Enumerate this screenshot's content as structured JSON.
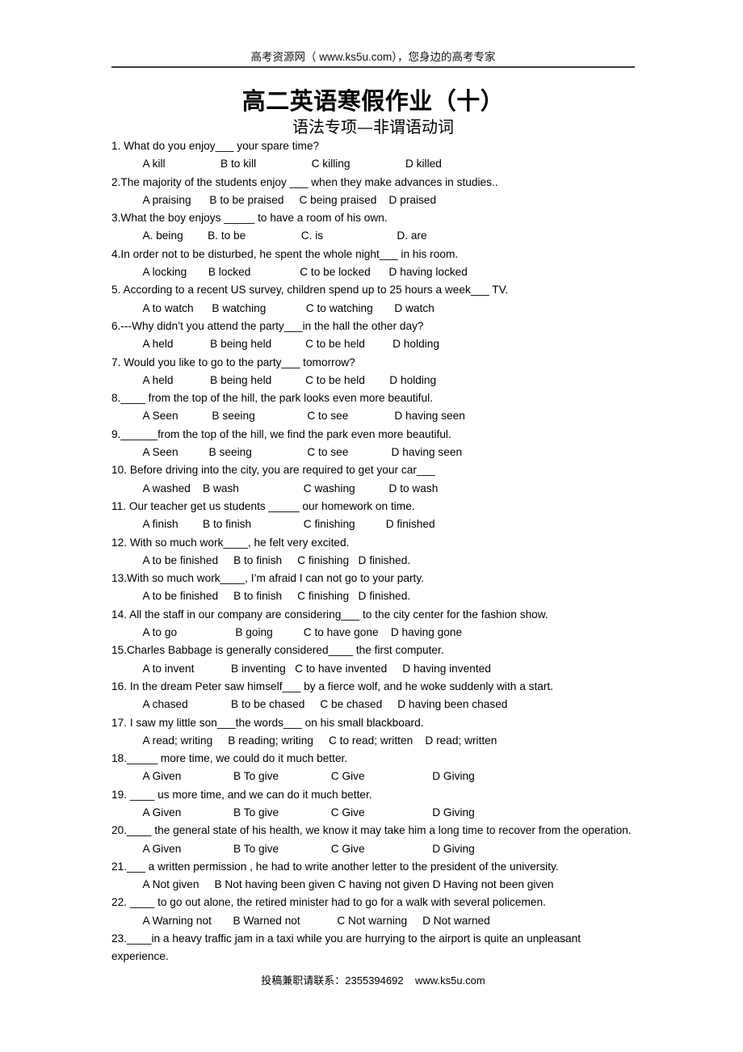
{
  "header": {
    "text": "高考资源网（ www.ks5u.com），您身边的高考专家"
  },
  "title": "高二英语寒假作业（十）",
  "subtitle": "语法专项—非谓语动词",
  "questions": [
    {
      "stem": "1. What do you enjoy___ your spare time?",
      "options": "    A kill                  B to kill                  C killing                  D killed"
    },
    {
      "stem": "2.The majority of the students enjoy ___ when they make advances in studies..",
      "options": "    A praising      B to be praised     C being praised    D praised"
    },
    {
      "stem": "3.What the boy enjoys _____ to have a room of his own.",
      "options": "    A. being        B. to be                  C. is                        D. are"
    },
    {
      "stem": "4.In order not to be disturbed, he spent the whole night___ in his room.",
      "options": "    A locking       B locked                C to be locked      D having locked"
    },
    {
      "stem": "5. According to a recent US survey, children spend up to 25 hours a week___ TV.",
      "options": "    A to watch      B watching             C to watching       D watch"
    },
    {
      "stem": "6.---Why didn’t you attend the party___in the hall the other day?",
      "options": "    A held            B being held           C to be held         D holding"
    },
    {
      "stem": "7. Would you like to go to the party___ tomorrow?",
      "options": "    A held            B being held           C to be held        D holding"
    },
    {
      "stem": "8.____ from the top of the hill, the park looks even more beautiful.",
      "options": "    A Seen           B seeing                 C to see               D having seen"
    },
    {
      "stem": "9.______from the top of the hill, we find the park even more beautiful.",
      "options": "    A Seen          B seeing                  C to see              D having seen"
    },
    {
      "stem": "10. Before driving into the city, you are required to get your car___",
      "options": "    A washed    B wash                     C washing           D to wash"
    },
    {
      "stem": "11. Our teacher get us students _____ our homework on time.",
      "options": "    A finish        B to finish                 C finishing          D finished"
    },
    {
      "stem": "12. With so much work____, he felt very excited.",
      "options": "    A to be finished     B to finish     C finishing   D finished."
    },
    {
      "stem": "13.With so much work____, I’m afraid I can not go to your party.",
      "options": "    A to be finished     B to finish     C finishing   D finished."
    },
    {
      "stem": "14. All the staff in our company are considering___ to the city center for the fashion show.",
      "options": "    A to go                   B going          C to have gone    D having gone"
    },
    {
      "stem": "15.Charles Babbage is generally considered____ the first computer.",
      "options": "    A to invent            B inventing   C to have invented     D having invented"
    },
    {
      "stem": "16. In the dream Peter saw himself___ by a fierce wolf, and he woke suddenly with a start.",
      "options": "    A chased              B to be chased     C be chased     D having been chased"
    },
    {
      "stem": "17. I saw my little son___the words___ on his small blackboard.",
      "options": "    A read; writing     B reading; writing     C to read; written    D read; written"
    },
    {
      "stem": "18._____ more time, we could do it much better.",
      "options": "    A Given                 B To give                 C Give                      D Giving"
    },
    {
      "stem": "19. ____ us more time, and we can do it much better.",
      "options": "    A Given                 B To give                 C Give                      D Giving"
    },
    {
      "stem": "20.____ the general state of his health, we know it may take him a long time to recover from the operation.",
      "options": "    A Given                 B To give                 C Give                      D Giving"
    },
    {
      "stem": "21.___ a written permission , he had to write another letter to the president of the university.",
      "options": "    A Not given     B Not having been given C having not given D Having not been given"
    },
    {
      "stem": "22. ____ to go out alone, the retired minister had to go for a walk with several policemen.",
      "options": "    A Warning not       B Warned not            C Not warning     D Not warned"
    },
    {
      "stem": "23.____in a heavy traffic jam in a taxi while you are hurrying to the airport is quite an unpleasant experience.",
      "options": ""
    }
  ],
  "footer": {
    "text": "投稿兼职请联系：2355394692    www.ks5u.com"
  }
}
